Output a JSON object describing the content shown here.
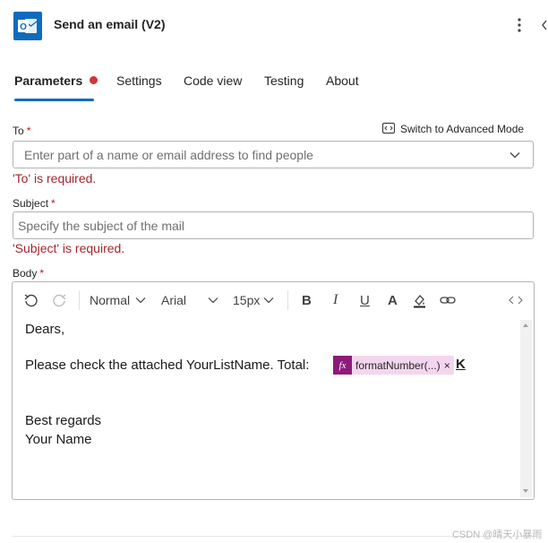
{
  "header": {
    "title": "Send an email (V2)",
    "app_icon": "outlook-icon",
    "more_icon": "more-vertical-icon",
    "collapse_icon": "collapse-panel-icon"
  },
  "tabs": [
    {
      "label": "Parameters",
      "active": true,
      "has_error_dot": true
    },
    {
      "label": "Settings",
      "active": false
    },
    {
      "label": "Code view",
      "active": false
    },
    {
      "label": "Testing",
      "active": false
    },
    {
      "label": "About",
      "active": false
    }
  ],
  "fields": {
    "to": {
      "label": "To",
      "required_mark": "*",
      "placeholder": "Enter part of a name or email address to find people",
      "value": "",
      "error": "'To' is required."
    },
    "advanced_mode": {
      "label": "Switch to Advanced Mode",
      "icon": "code-view-icon"
    },
    "subject": {
      "label": "Subject",
      "required_mark": "*",
      "placeholder": "Specify the subject of the mail",
      "value": "",
      "error": "'Subject' is required."
    },
    "body": {
      "label": "Body",
      "required_mark": "*"
    }
  },
  "editor": {
    "toolbar": {
      "undo_icon": "undo-icon",
      "redo_icon": "redo-icon",
      "paragraph_style": "Normal",
      "font_family": "Arial",
      "font_size": "15px",
      "bold_label": "B",
      "italic_label": "I",
      "underline_label": "U",
      "font_color_label": "A",
      "highlight_icon": "highlight-fill-icon",
      "link_icon": "link-icon",
      "code_view_icon": "code-view-icon"
    },
    "content": {
      "greeting": "Dears,",
      "body_line": "Please check the attached YourListName. Total:",
      "token_fx": "fx",
      "token_label": "formatNumber(...)",
      "token_remove": "×",
      "suffix": "K",
      "closing": "Best regards",
      "signature": "Your Name"
    }
  },
  "watermark": "CSDN @晴天小暴雨",
  "colors": {
    "accent": "#0f6cbd",
    "error": "#a4262c",
    "error_dot": "#d13438",
    "token_bg": "#f3d6ee",
    "token_fx_bg": "#8c1b7a"
  }
}
